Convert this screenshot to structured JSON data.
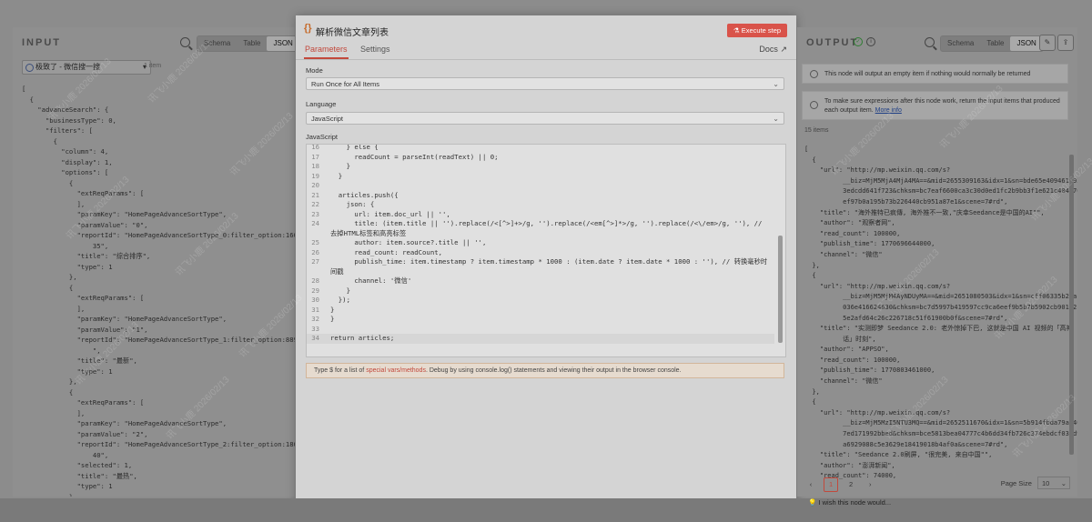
{
  "input": {
    "title": "INPUT",
    "tabs": [
      "Schema",
      "Table",
      "JSON"
    ],
    "active_tab": "JSON",
    "node_select": "极致了 - 微信搜一搜",
    "item_count": "1 item",
    "json_lines": [
      "[",
      "  {",
      "    \"advanceSearch\": {",
      "      \"businessType\": 0,",
      "      \"filters\": [",
      "        {",
      "          \"column\": 4,",
      "          \"display\": 1,",
      "          \"options\": [",
      "            {",
      "              \"extReqParams\": [",
      "              ],",
      "              \"paramKey\": \"HomePageAdvanceSortType\",",
      "              \"paramValue\": \"0\",",
      "              \"reportId\": \"HomePageAdvanceSortType_0:filter_option:16012336",
      "                  35\",",
      "              \"title\": \"综合排序\",",
      "              \"type\": 1",
      "            },",
      "            {",
      "              \"extReqParams\": [",
      "              ],",
      "              \"paramKey\": \"HomePageAdvanceSortType\",",
      "              \"paramValue\": \"1\",",
      "              \"reportId\": \"HomePageAdvanceSortType_1:filter_option:88998772",
      "                  \",",
      "              \"title\": \"最新\",",
      "              \"type\": 1",
      "            },",
      "            {",
      "              \"extReqParams\": [",
      "              ],",
      "              \"paramKey\": \"HomePageAdvanceSortType\",",
      "              \"paramValue\": \"2\",",
      "              \"reportId\": \"HomePageAdvanceSortType_2:filter_option:18050644",
      "                  40\",",
      "              \"selected\": 1,",
      "              \"title\": \"最热\",",
      "              \"type\": 1",
      "            }"
    ]
  },
  "modal": {
    "title": "解析微信文章列表",
    "execute_label": "Execute step",
    "tabs": [
      "Parameters",
      "Settings"
    ],
    "docs_label": "Docs",
    "mode_label": "Mode",
    "mode_value": "Run Once for All Items",
    "language_label": "Language",
    "language_value": "JavaScript",
    "code_label": "JavaScript",
    "code_lines": [
      {
        "n": "16",
        "t": "    } else {"
      },
      {
        "n": "17",
        "t": "      readCount = parseInt(readText) || 0;"
      },
      {
        "n": "18",
        "t": "    }"
      },
      {
        "n": "19",
        "t": "  }"
      },
      {
        "n": "20",
        "t": ""
      },
      {
        "n": "21",
        "t": "  articles.push({"
      },
      {
        "n": "22",
        "t": "    json: {"
      },
      {
        "n": "23",
        "t": "      url: item.doc_url || '',"
      },
      {
        "n": "24",
        "t": "      title: (item.title || '').replace(/<[^>]+>/g, '').replace(/<em[^>]*>/g, '').replace(/<\\/em>/g, ''), //"
      },
      {
        "n": "",
        "t": "去掉HTML标签和高亮标签"
      },
      {
        "n": "25",
        "t": "      author: item.source?.title || '',"
      },
      {
        "n": "26",
        "t": "      read_count: readCount,"
      },
      {
        "n": "27",
        "t": "      publish_time: item.timestamp ? item.timestamp * 1000 : (item.date ? item.date * 1000 : ''), // 转换毫秒时"
      },
      {
        "n": "",
        "t": "间戳"
      },
      {
        "n": "28",
        "t": "      channel: '微信'"
      },
      {
        "n": "29",
        "t": "    }"
      },
      {
        "n": "30",
        "t": "  });"
      },
      {
        "n": "31",
        "t": "}"
      },
      {
        "n": "32",
        "t": "}"
      },
      {
        "n": "33",
        "t": ""
      },
      {
        "n": "34",
        "t": "return articles;"
      }
    ],
    "hint_pre": "Type $ for a list of ",
    "hint_link": "special vars/methods",
    "hint_post": ". Debug by using console.log() statements and viewing their output in the browser console."
  },
  "output": {
    "title": "OUTPUT",
    "tabs": [
      "Schema",
      "Table",
      "JSON"
    ],
    "active_tab": "JSON",
    "notice1": "This node will output an empty item if nothing would normally be returned",
    "notice2": "To make sure expressions after this node work, return the input items that produced each output item.",
    "notice2_link": "More info",
    "items_count": "15 items",
    "json_lines": [
      "[",
      "  {",
      "    \"url\": \"http://mp.weixin.qq.com/s?",
      "          __biz=MjM5MjA4MjA4MA==&mid=2655309163&idx=1&sn=bde65e4094614934e9e",
      "          3edcdd641f723&chksm=bc7eaf6600ca3c30d0ed1fc2b9bb3f1e621c404f70f770",
      "          ef97b0a195b73b226440cb951a87e1&scene=7#rd\",",
      "    \"title\": \"海外推特已疯傳, 海外推不一致,\"庆幸Seedance是中国的AI\"\",",
      "    \"author\": \"观察者网\",",
      "    \"read_count\": 100000,",
      "    \"publish_time\": 1770696644000,",
      "    \"channel\": \"微信\"",
      "  },",
      "  {",
      "    \"url\": \"http://mp.weixin.qq.com/s?",
      "          __biz=MjM5MjM4AyNDUyMA==&mid=2651080503&idx=1&sn=cff06335b27ac78361b",
      "          036e416624630&chksm=bc7d5997b419597cc9ca6eef9b5b7b5902cb901b21dc48",
      "          5e2afd64c26c226718c51f61900b0f&scene=7#rd\",",
      "    \"title\": \"实测即梦 Seedance 2.0: 老外惊掉下巴, 这就是中国 AI 视频的「高神",
      "          话」时刻\",",
      "    \"author\": \"APPSO\",",
      "    \"read_count\": 100000,",
      "    \"publish_time\": 1770803461000,",
      "    \"channel\": \"微信\"",
      "  },",
      "  {",
      "    \"url\": \"http://mp.weixin.qq.com/s?",
      "          __biz=MjM5MzI5NTU3MQ==&mid=2652511670&idx=1&sn=5b914fbda79a54064c5",
      "          7ed171992bbed&chksm=bce5813bea04777c4b6dd34fb726c374ebdcf032d958",
      "          a6929088c5e3629e18419018b4af0a&scene=7#rd\",",
      "    \"title\": \"Seedance 2.0刷屏, \"很完美, 来自中国\"\",",
      "    \"author\": \"澎湃新闻\",",
      "    \"read_count\": 74000,"
    ],
    "pages": [
      "1",
      "2"
    ],
    "page_size_label": "Page Size",
    "page_size_value": "10"
  },
  "footer": {
    "feedback": "I wish this node would..."
  },
  "watermark": "讯飞小鹿 2026/02/13"
}
